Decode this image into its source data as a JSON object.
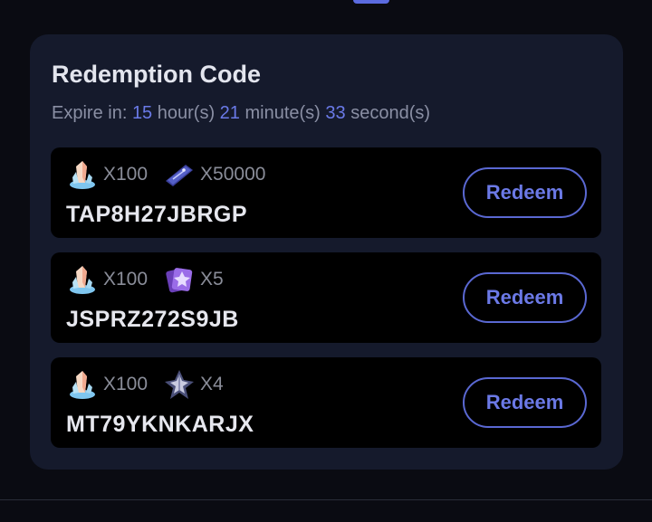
{
  "card": {
    "title": "Redemption Code",
    "expire": {
      "prefix": "Expire in:",
      "hours": "15",
      "hours_unit": "hour(s)",
      "minutes": "21",
      "minutes_unit": "minute(s)",
      "seconds": "33",
      "seconds_unit": "second(s)"
    },
    "codes": [
      {
        "rewards": [
          {
            "icon": "crystal-icon",
            "qty": "X100"
          },
          {
            "icon": "ticket-icon",
            "qty": "X50000"
          }
        ],
        "code": "TAP8H27JBRGP",
        "button": "Redeem"
      },
      {
        "rewards": [
          {
            "icon": "crystal-icon",
            "qty": "X100"
          },
          {
            "icon": "card-pack-icon",
            "qty": "X5"
          }
        ],
        "code": "JSPRZ272S9JB",
        "button": "Redeem"
      },
      {
        "rewards": [
          {
            "icon": "crystal-icon",
            "qty": "X100"
          },
          {
            "icon": "shard-icon",
            "qty": "X4"
          }
        ],
        "code": "MT79YKNKARJX",
        "button": "Redeem"
      }
    ]
  },
  "colors": {
    "accent": "#6a7ae8",
    "card_bg": "#151a2c",
    "row_bg": "#000000"
  }
}
